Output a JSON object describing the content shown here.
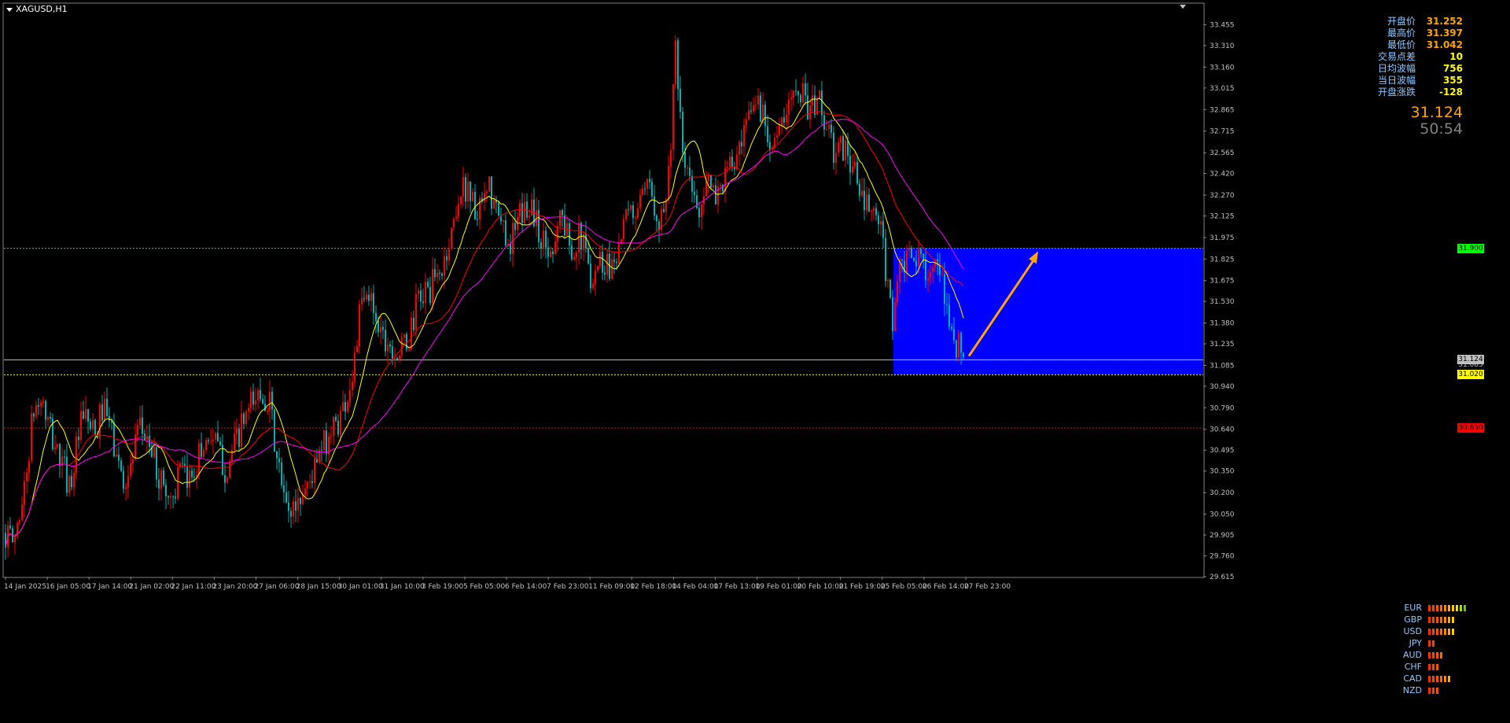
{
  "symbol_label": "XAGUSD,H1",
  "info_panel": [
    {
      "label": "开盘价",
      "value": "31.252",
      "color": "#ffa500"
    },
    {
      "label": "最高价",
      "value": "31.397",
      "color": "#ffa500"
    },
    {
      "label": "最低价",
      "value": "31.042",
      "color": "#ffa500"
    },
    {
      "label": "交易点差",
      "value": "10",
      "color": "#ffff00"
    },
    {
      "label": "日均波幅",
      "value": "756",
      "color": "#ffff00"
    },
    {
      "label": "当日波幅",
      "value": "355",
      "color": "#ffff00"
    },
    {
      "label": "开盘涨跌",
      "value": "-128",
      "color": "#ffff00"
    }
  ],
  "current_price": "31.124",
  "countdown": "50:54",
  "currency_strength": [
    {
      "name": "EUR",
      "level": 10
    },
    {
      "name": "GBP",
      "level": 7
    },
    {
      "name": "USD",
      "level": 7
    },
    {
      "name": "JPY",
      "level": 2
    },
    {
      "name": "AUD",
      "level": 4
    },
    {
      "name": "CHF",
      "level": 3
    },
    {
      "name": "CAD",
      "level": 6
    },
    {
      "name": "NZD",
      "level": 3
    }
  ],
  "colors": {
    "bull": "#ff0000",
    "bear": "#00b2b2",
    "ma_fast": "#ffff00",
    "ma_mid": "#ff0000",
    "ma_slow": "#ff00ff",
    "zone": "#0000ff",
    "arrow": "#ffa500",
    "grid_text": "#c0c0c0"
  },
  "chart_data": {
    "type": "candlestick",
    "symbol": "XAGUSD",
    "timeframe": "H1",
    "ylim": [
      29.615,
      33.6
    ],
    "y_ticks": [
      "33.455",
      "33.310",
      "33.160",
      "33.015",
      "32.865",
      "32.715",
      "32.565",
      "32.420",
      "32.270",
      "32.125",
      "31.975",
      "31.825",
      "31.675",
      "31.530",
      "31.380",
      "31.235",
      "31.085",
      "30.940",
      "30.790",
      "30.640",
      "30.495",
      "30.350",
      "30.200",
      "30.050",
      "29.905",
      "29.760",
      "29.615"
    ],
    "x_ticks": [
      "14 Jan 2025",
      "16 Jan 05:00",
      "17 Jan 14:00",
      "21 Jan 02:00",
      "22 Jan 11:00",
      "23 Jan 20:00",
      "27 Jan 06:00",
      "28 Jan 15:00",
      "30 Jan 01:00",
      "31 Jan 10:00",
      "3 Feb 19:00",
      "5 Feb 05:00",
      "6 Feb 14:00",
      "7 Feb 23:00",
      "11 Feb 09:00",
      "12 Feb 18:00",
      "14 Feb 04:00",
      "17 Feb 13:00",
      "19 Feb 01:00",
      "20 Feb 10:00",
      "21 Feb 19:00",
      "25 Feb 05:00",
      "26 Feb 14:00",
      "27 Feb 23:00"
    ],
    "path": [
      [
        0,
        29.92
      ],
      [
        10,
        29.85
      ],
      [
        25,
        30.25
      ],
      [
        35,
        30.75
      ],
      [
        45,
        30.85
      ],
      [
        55,
        30.65
      ],
      [
        68,
        30.45
      ],
      [
        82,
        30.25
      ],
      [
        95,
        30.65
      ],
      [
        103,
        30.72
      ],
      [
        115,
        30.55
      ],
      [
        122,
        30.8
      ],
      [
        132,
        30.68
      ],
      [
        145,
        30.35
      ],
      [
        155,
        30.28
      ],
      [
        170,
        30.63
      ],
      [
        180,
        30.6
      ],
      [
        192,
        30.35
      ],
      [
        210,
        30.15
      ],
      [
        223,
        30.35
      ],
      [
        230,
        30.25
      ],
      [
        245,
        30.45
      ],
      [
        260,
        30.62
      ],
      [
        270,
        30.5
      ],
      [
        280,
        30.35
      ],
      [
        300,
        30.65
      ],
      [
        314,
        30.82
      ],
      [
        325,
        30.9
      ],
      [
        335,
        30.85
      ],
      [
        345,
        30.42
      ],
      [
        358,
        30.05
      ],
      [
        372,
        30.14
      ],
      [
        392,
        30.35
      ],
      [
        412,
        30.62
      ],
      [
        425,
        30.72
      ],
      [
        440,
        30.98
      ],
      [
        452,
        31.5
      ],
      [
        465,
        31.55
      ],
      [
        478,
        31.32
      ],
      [
        488,
        31.25
      ],
      [
        500,
        31.16
      ],
      [
        512,
        31.25
      ],
      [
        525,
        31.55
      ],
      [
        540,
        31.62
      ],
      [
        555,
        31.75
      ],
      [
        565,
        31.95
      ],
      [
        575,
        32.25
      ],
      [
        588,
        32.35
      ],
      [
        600,
        32.1
      ],
      [
        615,
        32.3
      ],
      [
        628,
        32.08
      ],
      [
        642,
        31.95
      ],
      [
        655,
        32.12
      ],
      [
        668,
        32.22
      ],
      [
        680,
        31.98
      ],
      [
        692,
        31.86
      ],
      [
        705,
        32.15
      ],
      [
        718,
        31.92
      ],
      [
        732,
        31.98
      ],
      [
        744,
        31.72
      ],
      [
        756,
        31.82
      ],
      [
        770,
        31.78
      ],
      [
        790,
        32.1
      ],
      [
        810,
        32.22
      ],
      [
        820,
        32.32
      ],
      [
        832,
        32.1
      ],
      [
        842,
        32.32
      ],
      [
        852,
        33.25
      ],
      [
        860,
        32.58
      ],
      [
        870,
        32.35
      ],
      [
        880,
        32.15
      ],
      [
        890,
        32.38
      ],
      [
        900,
        32.25
      ],
      [
        910,
        32.35
      ],
      [
        920,
        32.45
      ],
      [
        935,
        32.55
      ],
      [
        945,
        32.8
      ],
      [
        955,
        32.95
      ],
      [
        965,
        32.8
      ],
      [
        975,
        32.65
      ],
      [
        985,
        32.7
      ],
      [
        995,
        32.85
      ],
      [
        1005,
        33.1
      ],
      [
        1015,
        32.95
      ],
      [
        1025,
        32.85
      ],
      [
        1035,
        32.95
      ],
      [
        1045,
        32.7
      ],
      [
        1055,
        32.55
      ],
      [
        1068,
        32.6
      ],
      [
        1080,
        32.42
      ],
      [
        1090,
        32.2
      ],
      [
        1102,
        32.15
      ],
      [
        1112,
        32.05
      ],
      [
        1120,
        31.7
      ],
      [
        1128,
        31.42
      ],
      [
        1136,
        31.72
      ],
      [
        1146,
        31.8
      ],
      [
        1158,
        31.82
      ],
      [
        1172,
        31.78
      ],
      [
        1182,
        31.75
      ],
      [
        1195,
        31.55
      ],
      [
        1205,
        31.28
      ],
      [
        1218,
        31.15
      ],
      [
        1225,
        31.1
      ]
    ],
    "moving_averages": [
      {
        "name": "",
        "color": "#ffff00",
        "period": 12
      },
      {
        "name": "",
        "color": "#ff0000",
        "period": 28
      },
      {
        "name": "",
        "color": "#ff00ff",
        "period": 45
      }
    ],
    "horizontal_levels": [
      {
        "price": 31.9,
        "label": "31.900",
        "style": "dotted",
        "color": "#00ff00"
      },
      {
        "price": 31.124,
        "label": "31.124",
        "style": "solid",
        "color": "#c0c0c0"
      },
      {
        "price": 31.02,
        "label": "31.020",
        "style": "dotted",
        "color": "#ffff00"
      },
      {
        "price": 30.65,
        "label": "30.650",
        "style": "dotted",
        "color": "#ff0000"
      },
      {
        "price": 31.085,
        "label": "31.085",
        "style": "none",
        "color": "#c0c0c0"
      }
    ],
    "zone": {
      "price_top": 31.9,
      "price_bottom": 31.02,
      "color": "#0000ff"
    },
    "arrow": {
      "from_price": 31.15,
      "to_price": 31.88,
      "color": "#ffa500"
    }
  }
}
